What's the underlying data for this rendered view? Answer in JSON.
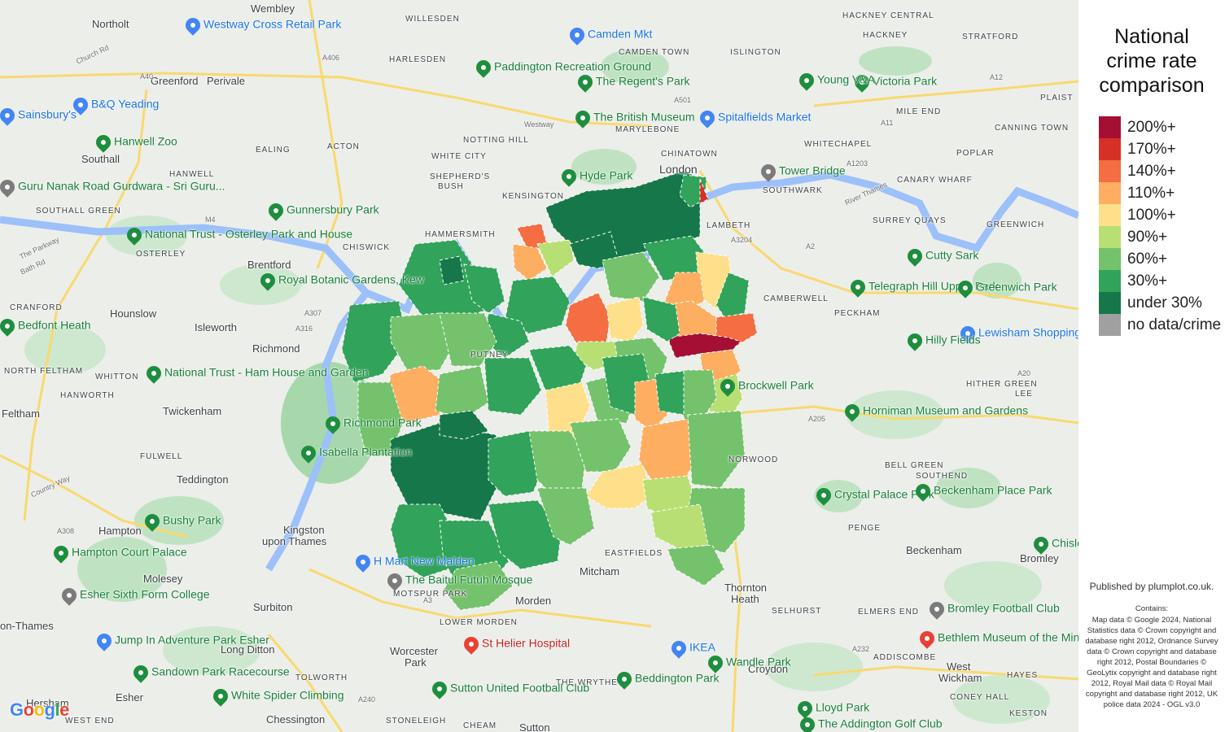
{
  "legend": {
    "title_lines": [
      "National",
      "crime rate",
      "comparison"
    ],
    "items": [
      {
        "label": "200%+",
        "color": "#a50f33"
      },
      {
        "label": "170%+",
        "color": "#d73027"
      },
      {
        "label": "140%+",
        "color": "#f46d43"
      },
      {
        "label": "110%+",
        "color": "#fdae61"
      },
      {
        "label": "100%+",
        "color": "#fee08b"
      },
      {
        "label": "90%+",
        "color": "#b8df73"
      },
      {
        "label": "60%+",
        "color": "#74c26b"
      },
      {
        "label": "30%+",
        "color": "#31a35a"
      },
      {
        "label": "under 30%",
        "color": "#16774a"
      },
      {
        "label": "no data/crime",
        "color": "#a0a0a0"
      }
    ]
  },
  "publisher": "Published by plumplot.co.uk.",
  "attribution_heading": "Contains:",
  "attribution": "Map data © Google 2024, National Statistics data © Crown copyright and database right 2012, Ordnance Survey data © Crown copyright and database right 2012, Postal Boundaries © GeoLytix copyright and database right 2012, Royal Mail data © Royal Mail copyright and database right 2012, UK police data 2024 - OGL v3.0",
  "google_logo": "Google",
  "places": [
    {
      "t": "Wembley",
      "c": "p-med"
    },
    {
      "t": "Northolt",
      "c": "p-med"
    },
    {
      "t": "WILLESDEN",
      "c": "p-sm"
    },
    {
      "t": "HARLESDEN",
      "c": "p-sm"
    },
    {
      "t": "CAMDEN TOWN",
      "c": "p-sm"
    },
    {
      "t": "ISLINGTON",
      "c": "p-sm"
    },
    {
      "t": "HACKNEY",
      "c": "p-sm"
    },
    {
      "t": "STRATFORD",
      "c": "p-sm"
    },
    {
      "t": "Greenford",
      "c": "p-med"
    },
    {
      "t": "Perivale",
      "c": "p-med"
    },
    {
      "t": "MARYLEBONE",
      "c": "p-sm"
    },
    {
      "t": "NOTTING HILL",
      "c": "p-sm"
    },
    {
      "t": "EALING",
      "c": "p-sm"
    },
    {
      "t": "Southall",
      "c": "p-med"
    },
    {
      "t": "WHITE CITY",
      "c": "p-sm"
    },
    {
      "t": "ACTON",
      "c": "p-sm"
    },
    {
      "t": "HANWELL",
      "c": "p-sm"
    },
    {
      "t": "SHEPHERD'S",
      "c": "p-sm"
    },
    {
      "t": "BUSH",
      "c": "p-sm"
    },
    {
      "t": "CHINATOWN",
      "c": "p-sm"
    },
    {
      "t": "London",
      "c": "p-big"
    },
    {
      "t": "WHITECHAPEL",
      "c": "p-sm"
    },
    {
      "t": "POPLAR",
      "c": "p-sm"
    },
    {
      "t": "CANARY WHARF",
      "c": "p-sm"
    },
    {
      "t": "KENSINGTON",
      "c": "p-sm"
    },
    {
      "t": "SOUTHWARK",
      "c": "p-sm"
    },
    {
      "t": "LAMBETH",
      "c": "p-sm"
    },
    {
      "t": "GREENWICH",
      "c": "p-sm"
    },
    {
      "t": "HAMMERSMITH",
      "c": "p-sm"
    },
    {
      "t": "CHISWICK",
      "c": "p-sm"
    },
    {
      "t": "Brentford",
      "c": "p-med"
    },
    {
      "t": "SURREY QUAYS",
      "c": "p-sm"
    },
    {
      "t": "CAMBERWELL",
      "c": "p-sm"
    },
    {
      "t": "PECKHAM",
      "c": "p-sm"
    },
    {
      "t": "Hounslow",
      "c": "p-med"
    },
    {
      "t": "Isleworth",
      "c": "p-med"
    },
    {
      "t": "PUTNEY",
      "c": "p-sm"
    },
    {
      "t": "Richmond",
      "c": "p-med"
    },
    {
      "t": "NORTH FELTHAM",
      "c": "p-sm"
    },
    {
      "t": "WHITTON",
      "c": "p-sm"
    },
    {
      "t": "HANWORTH",
      "c": "p-sm"
    },
    {
      "t": "Feltham",
      "c": "p-med"
    },
    {
      "t": "Twickenham",
      "c": "p-med"
    },
    {
      "t": "FULWELL",
      "c": "p-sm"
    },
    {
      "t": "Teddington",
      "c": "p-med"
    },
    {
      "t": "HITHER GREEN",
      "c": "p-sm"
    },
    {
      "t": "LEE",
      "c": "p-sm"
    },
    {
      "t": "NORWOOD",
      "c": "p-sm"
    },
    {
      "t": "BELL GREEN",
      "c": "p-sm"
    },
    {
      "t": "SOUTHEND",
      "c": "p-sm"
    },
    {
      "t": "Hampton",
      "c": "p-med"
    },
    {
      "t": "Kingston",
      "c": "p-med"
    },
    {
      "t": "upon Thames",
      "c": "p-med"
    },
    {
      "t": "PENGE",
      "c": "p-sm"
    },
    {
      "t": "Beckenham",
      "c": "p-med"
    },
    {
      "t": "Bromley",
      "c": "p-med"
    },
    {
      "t": "EASTFIELDS",
      "c": "p-sm"
    },
    {
      "t": "Mitcham",
      "c": "p-med"
    },
    {
      "t": "Molesey",
      "c": "p-med"
    },
    {
      "t": "Surbiton",
      "c": "p-med"
    },
    {
      "t": "MOTSPUR PARK",
      "c": "p-sm"
    },
    {
      "t": "Morden",
      "c": "p-med"
    },
    {
      "t": "Thornton",
      "c": "p-med"
    },
    {
      "t": "Heath",
      "c": "p-med"
    },
    {
      "t": "SELHURST",
      "c": "p-sm"
    },
    {
      "t": "ELMERS END",
      "c": "p-sm"
    },
    {
      "t": "LOWER MORDEN",
      "c": "p-sm"
    },
    {
      "t": "Worcester",
      "c": "p-med"
    },
    {
      "t": "Park",
      "c": "p-med"
    },
    {
      "t": "Long Ditton",
      "c": "p-med"
    },
    {
      "t": "ADDISCOMBE",
      "c": "p-sm"
    },
    {
      "t": "TOLWORTH",
      "c": "p-sm"
    },
    {
      "t": "West",
      "c": "p-med"
    },
    {
      "t": "Wickham",
      "c": "p-med"
    },
    {
      "t": "HAYES",
      "c": "p-sm"
    },
    {
      "t": "Croydon",
      "c": "p-med"
    },
    {
      "t": "THE WRYTHE",
      "c": "p-sm"
    },
    {
      "t": "Esher",
      "c": "p-med"
    },
    {
      "t": "CONEY HALL",
      "c": "p-sm"
    },
    {
      "t": "Chessington",
      "c": "p-med"
    },
    {
      "t": "STONELEIGH",
      "c": "p-sm"
    },
    {
      "t": "CHEAM",
      "c": "p-sm"
    },
    {
      "t": "Sutton",
      "c": "p-med"
    },
    {
      "t": "WEST END",
      "c": "p-sm"
    },
    {
      "t": "KESTON",
      "c": "p-sm"
    },
    {
      "t": "SOUTHALL GREEN",
      "c": "p-sm"
    },
    {
      "t": "OSTERLEY",
      "c": "p-sm"
    },
    {
      "t": "CRANFORD",
      "c": "p-sm"
    },
    {
      "t": "Hersham",
      "c": "p-med"
    },
    {
      "t": "on-Thames",
      "c": "p-med"
    },
    {
      "t": "MILE END",
      "c": "p-sm"
    },
    {
      "t": "CANNING TOWN",
      "c": "p-sm"
    },
    {
      "t": "PLAIST",
      "c": "p-sm"
    },
    {
      "t": "HACKNEY CENTRAL",
      "c": "p-sm"
    },
    {
      "t": "A40",
      "c": "p-road"
    },
    {
      "t": "A406",
      "c": "p-road"
    },
    {
      "t": "A501",
      "c": "p-road"
    },
    {
      "t": "A1203",
      "c": "p-road"
    },
    {
      "t": "A205",
      "c": "p-road"
    },
    {
      "t": "A232",
      "c": "p-road"
    },
    {
      "t": "A3",
      "c": "p-road"
    },
    {
      "t": "A20",
      "c": "p-road"
    },
    {
      "t": "M4",
      "c": "p-road"
    },
    {
      "t": "A2",
      "c": "p-road"
    },
    {
      "t": "A240",
      "c": "p-road"
    },
    {
      "t": "A308",
      "c": "p-road"
    },
    {
      "t": "A316",
      "c": "p-road"
    },
    {
      "t": "A307",
      "c": "p-road"
    },
    {
      "t": "A12",
      "c": "p-road"
    },
    {
      "t": "A11",
      "c": "p-road"
    },
    {
      "t": "A3204",
      "c": "p-road"
    },
    {
      "t": "Westway",
      "c": "p-road"
    },
    {
      "t": "River Thames",
      "c": "p-road"
    },
    {
      "t": "Church Rd",
      "c": "p-road"
    },
    {
      "t": "Bath Rd",
      "c": "p-road"
    },
    {
      "t": "Country Way",
      "c": "p-road"
    },
    {
      "t": "The Parkway",
      "c": "p-road"
    }
  ],
  "pois": [
    {
      "t": "Westway Cross Retail Park",
      "c": "blue"
    },
    {
      "t": "Camden Mkt",
      "c": "blue"
    },
    {
      "t": "Paddington Recreation Ground",
      "c": "green"
    },
    {
      "t": "The Regent's Park",
      "c": "green"
    },
    {
      "t": "Victoria Park",
      "c": "green"
    },
    {
      "t": "Young V&A",
      "c": "green"
    },
    {
      "t": "B&Q Yeading",
      "c": "blue"
    },
    {
      "t": "Sainsbury's",
      "c": "blue"
    },
    {
      "t": "The British Museum",
      "c": "green"
    },
    {
      "t": "Spitalfields Market",
      "c": "blue"
    },
    {
      "t": "Hanwell Zoo",
      "c": "green"
    },
    {
      "t": "Hyde Park",
      "c": "green"
    },
    {
      "t": "Tower Bridge",
      "c": "green"
    },
    {
      "t": "Guru Nanak Road Gurdwara - Sri Guru...",
      "c": "green"
    },
    {
      "t": "Gunnersbury Park",
      "c": "green"
    },
    {
      "t": "National Trust - Osterley Park and House",
      "c": "green"
    },
    {
      "t": "Cutty Sark",
      "c": "green"
    },
    {
      "t": "Royal Botanic Gardens, Kew",
      "c": "green"
    },
    {
      "t": "Telegraph Hill Upper Park",
      "c": "green"
    },
    {
      "t": "Greenwich Park",
      "c": "green"
    },
    {
      "t": "Lewisham Shopping Centre",
      "c": "blue"
    },
    {
      "t": "Hilly Fields",
      "c": "green"
    },
    {
      "t": "National Trust - Ham House and Garden",
      "c": "green"
    },
    {
      "t": "Bedfont Heath",
      "c": "green"
    },
    {
      "t": "Richmond Park",
      "c": "green"
    },
    {
      "t": "Isabella Plantation",
      "c": "green"
    },
    {
      "t": "Horniman Museum and Gardens",
      "c": "green"
    },
    {
      "t": "Brockwell Park",
      "c": "green"
    },
    {
      "t": "Crystal Palace Park",
      "c": "green"
    },
    {
      "t": "Beckenham Place Park",
      "c": "green"
    },
    {
      "t": "Bushy Park",
      "c": "green"
    },
    {
      "t": "Hampton Court Palace",
      "c": "green"
    },
    {
      "t": "H Mart New Malden",
      "c": "blue"
    },
    {
      "t": "The Baitul Futuh Mosque",
      "c": "green"
    },
    {
      "t": "Esher Sixth Form College",
      "c": "green"
    },
    {
      "t": "Bromley Football Club",
      "c": "green"
    },
    {
      "t": "Jump In Adventure Park Esher",
      "c": "green"
    },
    {
      "t": "St Helier Hospital",
      "c": "red"
    },
    {
      "t": "IKEA",
      "c": "blue"
    },
    {
      "t": "Bethlem Museum of the Mind",
      "c": "green"
    },
    {
      "t": "Sandown Park Racecourse",
      "c": "green"
    },
    {
      "t": "Beddington Park",
      "c": "green"
    },
    {
      "t": "Wandle Park",
      "c": "green"
    },
    {
      "t": "Sutton United Football Club",
      "c": "green"
    },
    {
      "t": "White Spider Climbing",
      "c": "green"
    },
    {
      "t": "Lloyd Park",
      "c": "green"
    },
    {
      "t": "The Addington Golf Club",
      "c": "green"
    },
    {
      "t": "Chislehurst",
      "c": "green"
    }
  ]
}
